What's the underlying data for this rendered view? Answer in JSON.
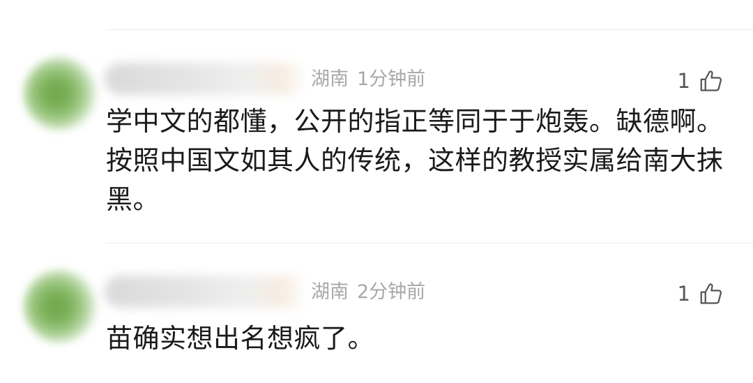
{
  "comments": [
    {
      "location": "湖南",
      "time": "1分钟前",
      "likes": "1",
      "text": "学中文的都懂，公开的指正等同于于炮轰。缺德啊。按照中国文如其人的传统，这样的教授实属给南大抹黑。"
    },
    {
      "location": "湖南",
      "time": "2分钟前",
      "likes": "1",
      "text": "苗确实想出名想疯了。"
    }
  ],
  "icons": {
    "avatar": "avatar-blurred",
    "like": "thumbs-up-icon"
  },
  "colors": {
    "meta_text": "#a8a8a8",
    "body_text": "#1a1a1a",
    "divider": "#ececec",
    "avatar_green": "#7fb35c"
  }
}
